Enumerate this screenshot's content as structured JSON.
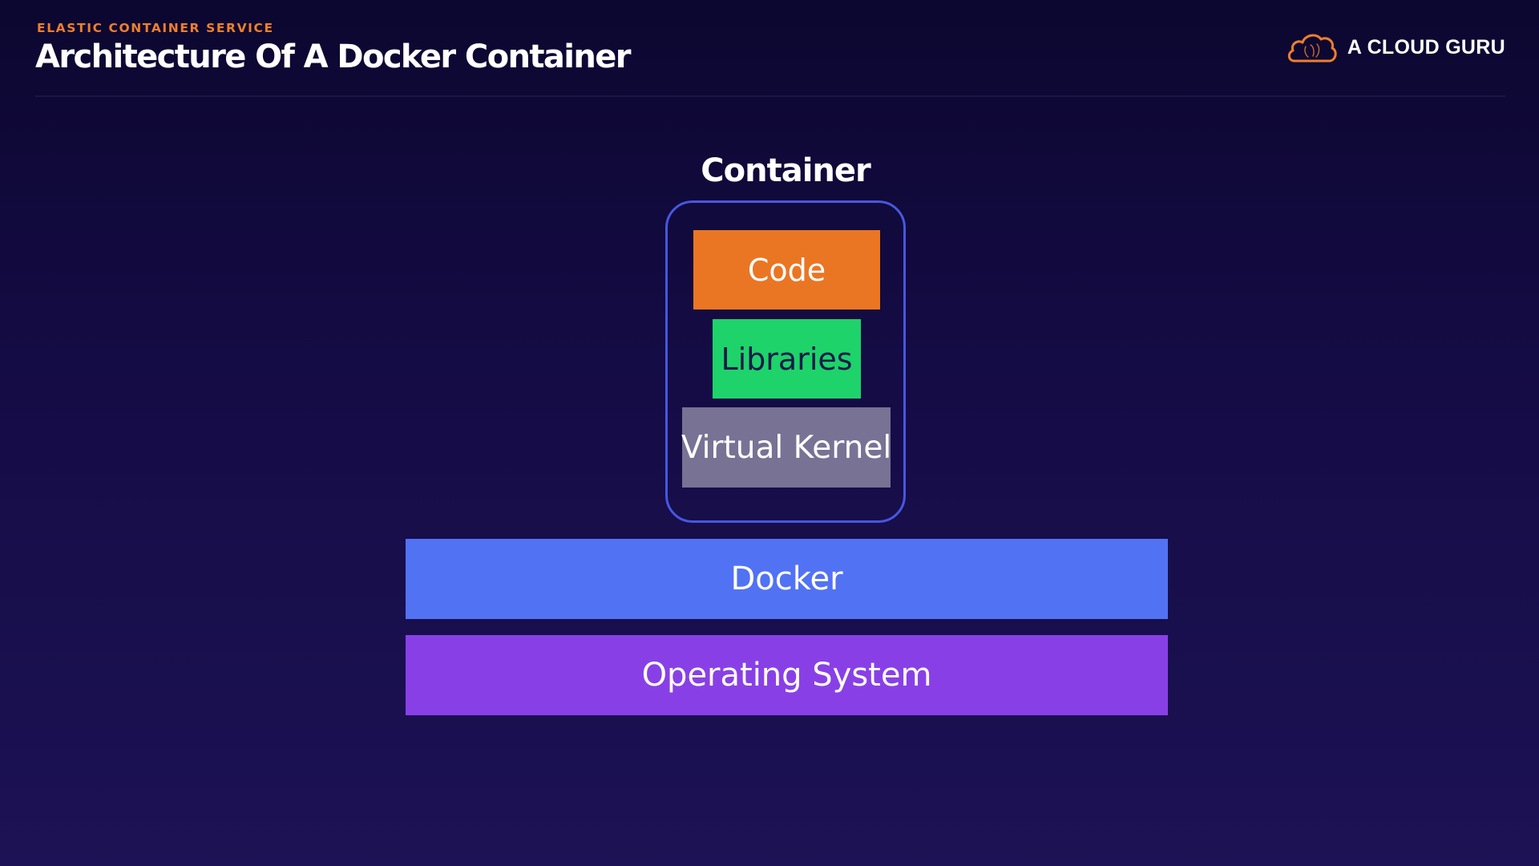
{
  "header": {
    "eyebrow": "ELASTIC CONTAINER SERVICE",
    "title": "Architecture Of A Docker Container"
  },
  "brand": {
    "logo_icon": "cloud-icon",
    "name": "A CLOUD GURU"
  },
  "diagram": {
    "container_label": "Container",
    "container_layers": [
      "Code",
      "Libraries",
      "Virtual Kernel"
    ],
    "host_layers": [
      "Docker",
      "Operating System"
    ]
  },
  "colors": {
    "accent_orange": "#ea7624",
    "code": "#ea7624",
    "libraries": "#1ed36a",
    "virtual_kernel": "#787294",
    "docker": "#5272f4",
    "operating_system": "#8840e6",
    "container_outline": "#4857e0"
  }
}
